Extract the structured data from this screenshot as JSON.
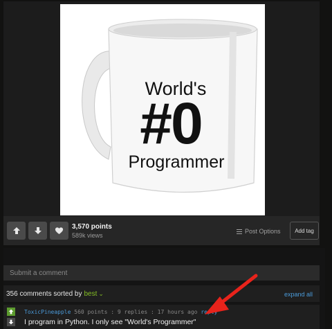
{
  "mug": {
    "line1": "World's",
    "line2": "#0",
    "line3": "Programmer"
  },
  "post": {
    "points": "3,570 points",
    "views": "589k views",
    "post_options": "Post Options",
    "add_tag": "Add tag"
  },
  "comments": {
    "input_placeholder": "Submit a comment",
    "count_text": "356 comments sorted by",
    "sort_value": "best",
    "expand_all": "expand all",
    "items": [
      {
        "username": "ToxicPineapple",
        "meta": "560 points : 9 replies : 17 hours ago",
        "reply": "reply",
        "text": "I program in Python. I only see \"World's Programmer\""
      }
    ]
  },
  "icons": [
    "upvote-icon",
    "downvote-icon",
    "heart-icon",
    "menu-icon",
    "chevron-down-icon"
  ],
  "colors": {
    "background": "#121211",
    "accent_green": "#85bf25",
    "link_blue": "#4a9ad9",
    "annotation_red": "#e8231b"
  }
}
